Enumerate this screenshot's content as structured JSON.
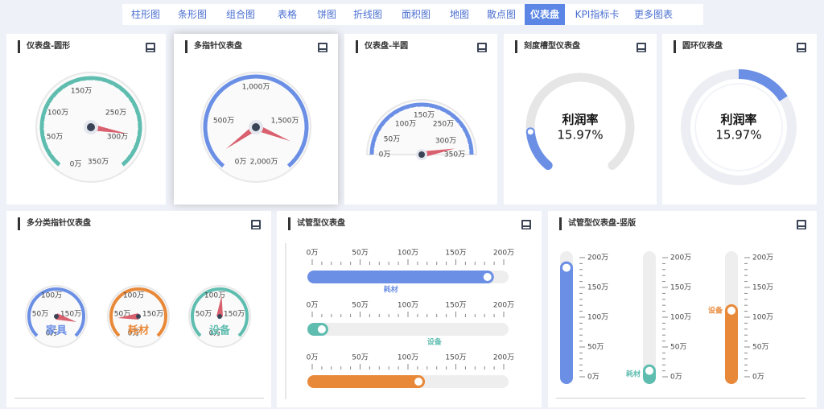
{
  "nav": {
    "items": [
      "柱形图",
      "条形图",
      "组合图",
      "表格",
      "饼图",
      "折线图",
      "面积图",
      "地图",
      "散点图",
      "仪表盘",
      "KPI指标卡",
      "更多图表"
    ],
    "active_index": 9
  },
  "colors": {
    "teal": "#5fbdb0",
    "blue": "#6b8fe5",
    "orange": "#e8893a",
    "needle": "#d9606e",
    "track": "#eeeeee",
    "dark": "#3b4456"
  },
  "cards": {
    "round": {
      "title": "仪表盘-圆形",
      "ticks": [
        "0万",
        "50万",
        "100万",
        "150万",
        "250万",
        "300万",
        "350万"
      ],
      "value": 300,
      "max": 350
    },
    "multi": {
      "title": "多指针仪表盘",
      "ticks": [
        "0万",
        "500万",
        "1,000万",
        "1,500万",
        "2,000万"
      ],
      "value_a": 100,
      "value_b": 1800,
      "max": 2000
    },
    "half": {
      "title": "仪表盘-半圆",
      "ticks": [
        "0万",
        "50万",
        "100万",
        "150万",
        "250万",
        "300万",
        "350万"
      ],
      "value": 330,
      "max": 350
    },
    "scale": {
      "title": "刻度槽型仪表盘",
      "label": "利润率",
      "value": "15.97%",
      "fraction": 0.1597
    },
    "ring": {
      "title": "圆环仪表盘",
      "label": "利润率",
      "value": "15.97%",
      "fraction": 0.1597
    },
    "category": {
      "title": "多分类指针仪表盘",
      "ticks": [
        "0万",
        "50万",
        "100万",
        "150万"
      ],
      "max": 200,
      "items": [
        {
          "name": "家具",
          "value": 178,
          "color": "#6b8fe5"
        },
        {
          "name": "耗材",
          "value": 30,
          "color": "#e8893a"
        },
        {
          "name": "设备",
          "value": 104,
          "color": "#5fbdb0"
        }
      ]
    },
    "tube_h": {
      "title": "试管型仪表盘",
      "ticks": [
        "0万",
        "50万",
        "100万",
        "150万",
        "200万"
      ],
      "max": 200,
      "items": [
        {
          "name": "耗材",
          "value": 183,
          "color": "#6b8fe5"
        },
        {
          "name": "设备",
          "value": 10,
          "color": "#5fbdb0"
        },
        {
          "name": "",
          "value": 111,
          "color": "#e8893a"
        }
      ]
    },
    "tube_v": {
      "title": "试管型仪表盘-竖版",
      "ticks": [
        "0万",
        "50万",
        "100万",
        "150万",
        "200万"
      ],
      "max": 200,
      "items": [
        {
          "name": "",
          "value": 183,
          "color": "#6b8fe5"
        },
        {
          "name": "耗材",
          "value": 10,
          "color": "#5fbdb0"
        },
        {
          "name": "设备",
          "value": 111,
          "color": "#e8893a"
        }
      ]
    }
  }
}
